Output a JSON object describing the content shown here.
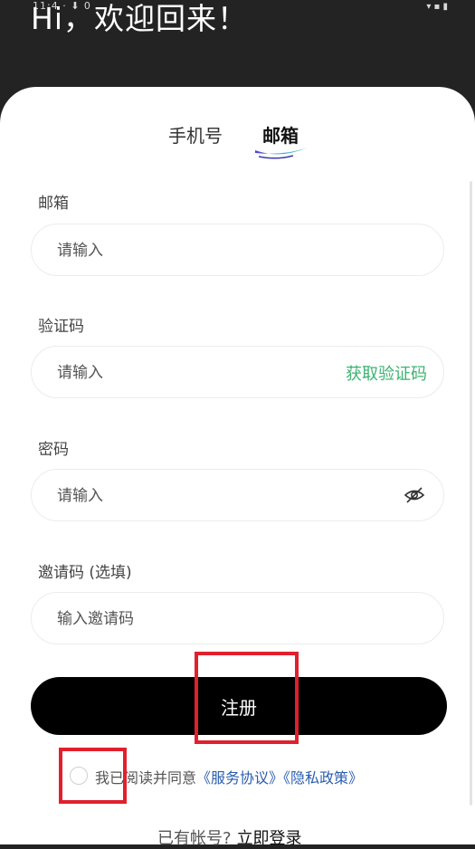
{
  "status_bar": {
    "left": "11:4  ·  ⬇  0",
    "right": "▾ ▪ ▮"
  },
  "welcome_title": "Hi，欢迎回来！",
  "tabs": [
    {
      "label": "手机号"
    },
    {
      "label": "邮箱"
    }
  ],
  "fields": {
    "email": {
      "label": "邮箱",
      "placeholder": "请输入"
    },
    "code": {
      "label": "验证码",
      "placeholder": "请输入",
      "action": "获取验证码"
    },
    "password": {
      "label": "密码",
      "placeholder": "请输入"
    },
    "invite": {
      "label": "邀请码 (选填)",
      "placeholder": "输入邀请码"
    }
  },
  "submit_label": "注册",
  "agreement": {
    "prefix": "我已阅读并同意",
    "terms": "《服务协议》",
    "privacy": "《隐私政策》"
  },
  "footer": {
    "text": "已有帐号?",
    "login": "立即登录"
  },
  "colors": {
    "accent_green": "#3cb371",
    "link_blue": "#2a5db0",
    "highlight_red": "#e0202e"
  }
}
